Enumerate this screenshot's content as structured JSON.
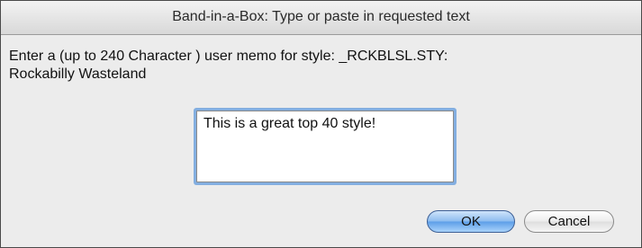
{
  "dialog": {
    "title": "Band-in-a-Box: Type or paste in requested text",
    "prompt": "Enter a (up to 240 Character ) user memo for style: _RCKBLSL.STY:\nRockabilly Wasteland",
    "memo_value": "This is a great top 40 style!",
    "ok_label": "OK",
    "cancel_label": "Cancel",
    "accent_color": "#83aee0"
  }
}
